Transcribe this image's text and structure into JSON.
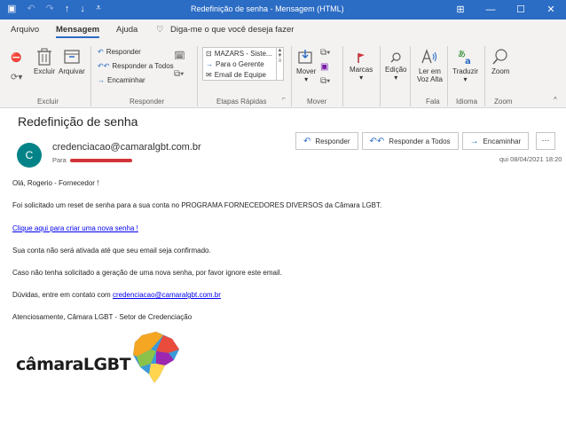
{
  "window": {
    "title": "Redefinição de senha - Mensagem (HTML)"
  },
  "menu": {
    "tabs": [
      "Arquivo",
      "Mensagem",
      "Ajuda"
    ],
    "active": "Mensagem",
    "tell_me": "Diga-me o que você deseja fazer"
  },
  "ribbon": {
    "delete_group": {
      "label": "Excluir",
      "delete": "Excluir",
      "archive": "Arquivar"
    },
    "respond_group": {
      "label": "Responder",
      "reply": "Responder",
      "reply_all": "Responder a Todos",
      "forward": "Encaminhar"
    },
    "quick_steps": {
      "label": "Etapas Rápidas",
      "items": [
        "MAZARS - Siste...",
        "Para o Gerente",
        "Email de Equipe"
      ]
    },
    "move_group": {
      "label": "Mover",
      "move": "Mover"
    },
    "tags": {
      "label": "Marcas"
    },
    "edit": {
      "label": "Edição"
    },
    "speech": {
      "label": "Fala",
      "read_aloud_1": "Ler em",
      "read_aloud_2": "Voz Alta"
    },
    "language": {
      "label": "Idioma",
      "translate": "Traduzir"
    },
    "zoom": {
      "label": "Zoom",
      "zoom": "Zoom"
    }
  },
  "message": {
    "subject": "Redefinição de senha",
    "avatar_initial": "C",
    "sender": "credenciacao@camaralgbt.com.br",
    "to_label": "Para",
    "datetime": "qui 08/04/2021 18:20",
    "actions": {
      "reply": "Responder",
      "reply_all": "Responder a Todos",
      "forward": "Encaminhar",
      "more": "···"
    },
    "body": {
      "greeting": "Olá, Rogerio - Fornecedor !",
      "line1": "Foi solicitado um reset de senha para a sua conta no PROGRAMA FORNECEDORES DIVERSOS da Câmara LGBT.",
      "link": "Clique aqui para criar uma nova senha !",
      "line2": "Sua conta não será ativada até que seu email seja confirmado.",
      "line3": "Caso não tenha solicitado a geração de uma nova senha, por favor ignore este email.",
      "line4_prefix": "Dúvidas, entre em contato com ",
      "line4_email": "credenciacao@camaralgbt.com.br",
      "signature": "Atenciosamente, Câmara LGBT - Setor de Credenciação"
    },
    "logo_text": "câmaraLGBT"
  },
  "colors": {
    "titlebar": "#2b6cc4",
    "ribbon": "#f3f2f1",
    "avatar": "#038387",
    "link": "#0000ee"
  }
}
